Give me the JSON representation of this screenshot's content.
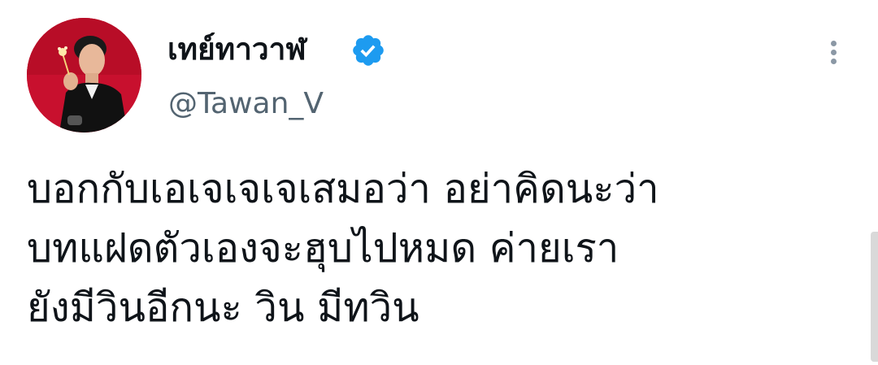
{
  "author": {
    "display_name": "เทย์ทาวาฬ",
    "handle": "@Tawan_V",
    "verified": true
  },
  "icons": {
    "verified": "verified-badge-icon",
    "more": "more-vertical-icon"
  },
  "tweet": {
    "lines": [
      "บอกกับเอเจเจเจเสมอว่า อย่าคิดนะว่า",
      "บทแฝดตัวเองจะฮุบไปหมด ค่ายเรา",
      "ยังมีวินอีกนะ วิน มีทวิน"
    ]
  },
  "colors": {
    "text": "#0f1419",
    "secondary": "#536471",
    "verified": "#1d9bf0",
    "avatar_bg": "#c8102e"
  }
}
